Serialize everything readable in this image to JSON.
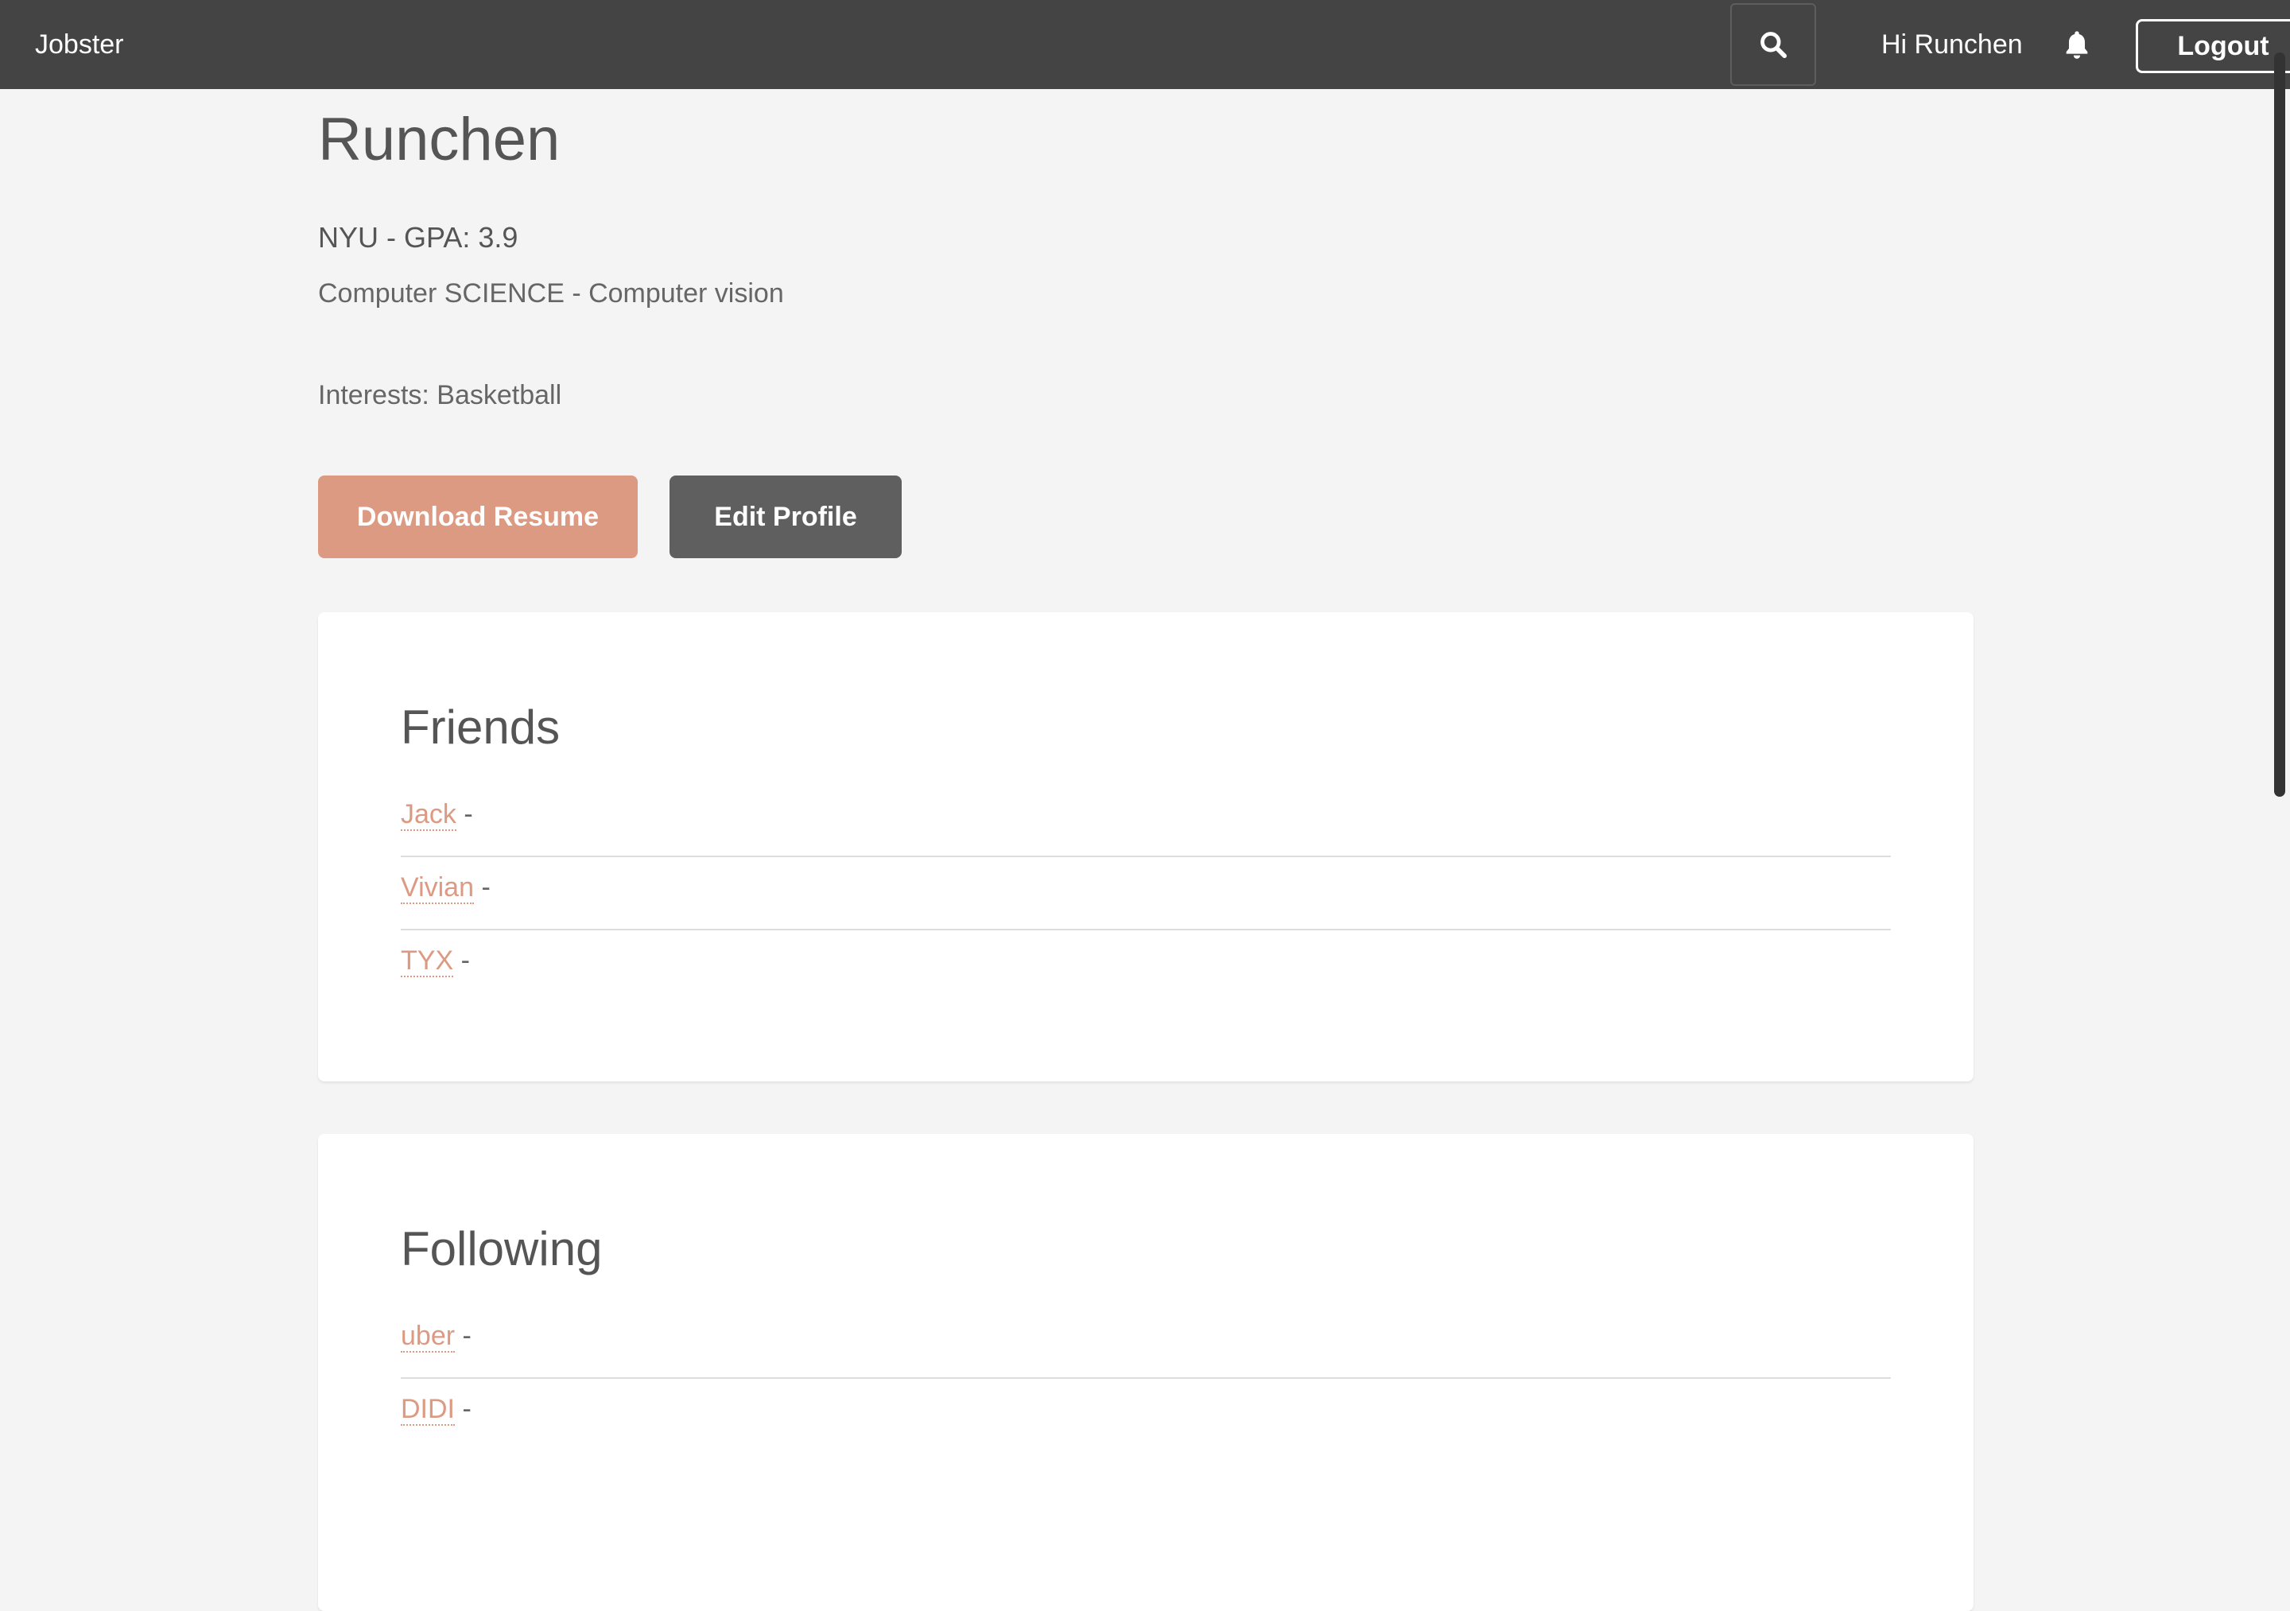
{
  "navbar": {
    "brand": "Jobster",
    "greeting": "Hi Runchen",
    "logout_label": "Logout",
    "search_icon": "search-icon",
    "bell_icon": "bell-icon"
  },
  "profile": {
    "name": "Runchen",
    "school": "NYU - GPA: 3.9",
    "major": "Computer SCIENCE - Computer vision",
    "interests": "Interests: Basketball",
    "download_label": "Download Resume",
    "edit_label": "Edit Profile"
  },
  "friends": {
    "title": "Friends",
    "items": [
      {
        "name": "Jack",
        "suffix": " -"
      },
      {
        "name": "Vivian",
        "suffix": " -"
      },
      {
        "name": "TYX",
        "suffix": " -"
      }
    ]
  },
  "following": {
    "title": "Following",
    "items": [
      {
        "name": "uber",
        "suffix": " -"
      },
      {
        "name": "DIDI",
        "suffix": " -"
      }
    ]
  },
  "colors": {
    "navbar_bg": "#444444",
    "accent": "#dd9a83",
    "edit_button": "#5f5f5f",
    "page_bg": "#f4f4f4"
  }
}
